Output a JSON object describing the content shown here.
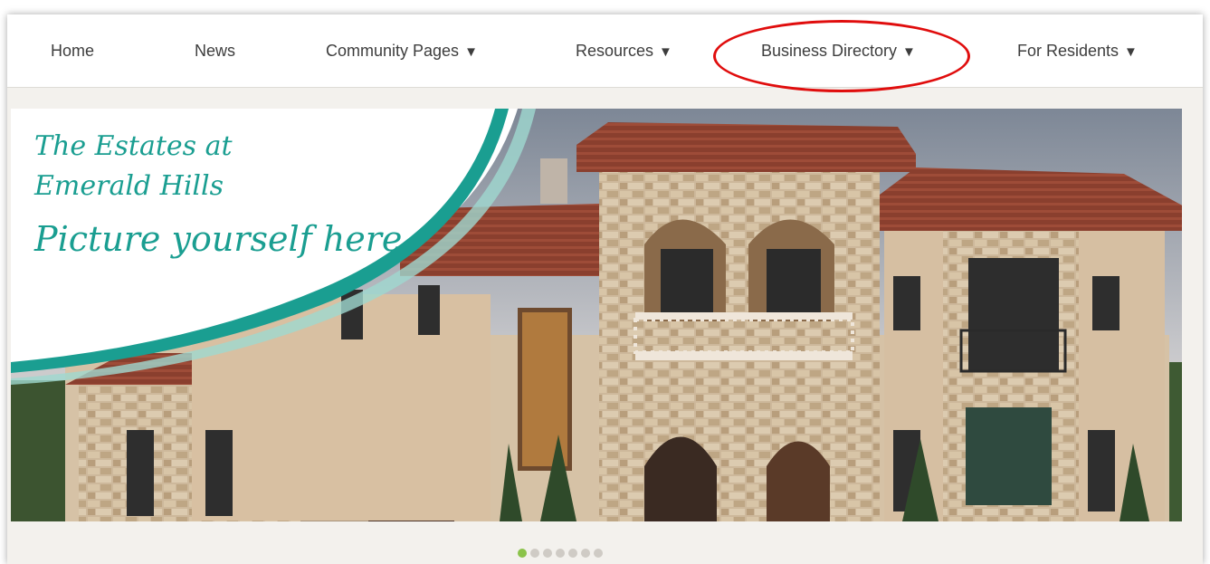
{
  "nav": {
    "items": [
      {
        "label": "Home",
        "dropdown": false
      },
      {
        "label": "News",
        "dropdown": false
      },
      {
        "label": "Community Pages",
        "dropdown": true
      },
      {
        "label": "Resources",
        "dropdown": true
      },
      {
        "label": "Business Directory",
        "dropdown": true
      },
      {
        "label": "For Residents",
        "dropdown": true
      }
    ],
    "caret": "▼",
    "highlighted_item": "Business Directory",
    "highlight_color": "#e00d0d"
  },
  "hero": {
    "line1": "The Estates at",
    "line2": "Emerald Hills",
    "tagline": "Picture yourself here",
    "accent_color": "#1a9e91"
  },
  "carousel": {
    "slide_count": 7,
    "active_index": 0,
    "active_color": "#8bc34a",
    "inactive_color": "#cfcbc5"
  }
}
